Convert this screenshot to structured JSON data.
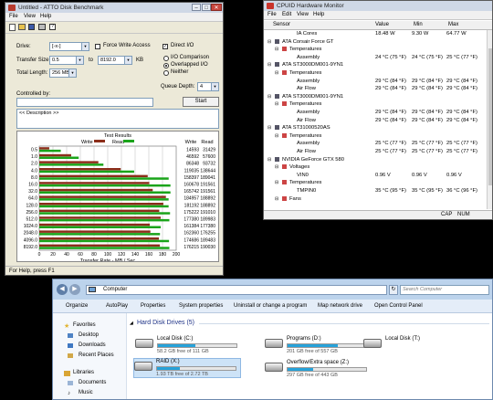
{
  "atto": {
    "title": "Untitled - ATTO Disk Benchmark",
    "menus": [
      "File",
      "View",
      "Help"
    ],
    "drive_label": "Drive:",
    "drive_value": "[-x-]",
    "force_write_access": "Force Write Access",
    "direct_io": "Direct I/O",
    "transfer_size_label": "Transfer Size:",
    "transfer_from": "0.5",
    "transfer_to_label": "to",
    "transfer_to": "8192.0",
    "kb": "KB",
    "total_length_label": "Total Length:",
    "total_length": "256 MB",
    "io_comparison": "I/O Comparison",
    "overlapped_io": "Overlapped I/O",
    "neither": "Neither",
    "queue_depth_label": "Queue Depth:",
    "queue_depth": "4",
    "controlled_by": "Controlled by:",
    "start": "Start",
    "description": "<< Description >>",
    "test_results": "Test Results",
    "legend_write": "Write",
    "legend_read": "Read",
    "col_write": "Write",
    "col_read": "Read",
    "xlabel": "Transfer Rate - MB / Sec",
    "status": "For Help, press F1"
  },
  "chart_data": {
    "type": "bar",
    "title": "Test Results",
    "xlabel": "Transfer Rate - MB / Sec",
    "xlim": [
      0,
      200
    ],
    "xticks": [
      "0",
      "20",
      "40",
      "60",
      "80",
      "100",
      "120",
      "140",
      "160",
      "180",
      "200"
    ],
    "categories": [
      "0.5",
      "1.0",
      "2.0",
      "4.0",
      "8.0",
      "16.0",
      "32.0",
      "64.0",
      "128.0",
      "256.0",
      "512.0",
      "1024.0",
      "2048.0",
      "4096.0",
      "8192.0"
    ],
    "series": [
      {
        "name": "Write",
        "color": "#8b2d1a",
        "values": [
          14.6,
          46.6,
          86.3,
          119.0,
          158.4,
          160.7,
          165.7,
          184.96,
          181.2,
          175.2,
          177.4,
          161.4,
          162.3,
          174.7,
          176.2
        ],
        "labels": [
          "14593",
          "46592",
          "86348",
          "119035",
          "158397",
          "160678",
          "165742",
          "184957",
          "181192",
          "175222",
          "177380",
          "161384",
          "162360",
          "174686",
          "176215"
        ]
      },
      {
        "name": "Read",
        "color": "#1aa41a",
        "values": [
          31.4,
          57.6,
          93.7,
          138.6,
          189.0,
          191.6,
          191.6,
          188.9,
          188.9,
          191.0,
          190.0,
          177.4,
          176.3,
          189.5,
          190.0
        ],
        "labels": [
          "31429",
          "57600",
          "93732",
          "138644",
          "189041",
          "191561",
          "191561",
          "188892",
          "188892",
          "191010",
          "189983",
          "177380",
          "176255",
          "189483",
          "190030"
        ]
      }
    ]
  },
  "hwmon": {
    "title": "CPUID Hardware Monitor",
    "menus": [
      "File",
      "Edit",
      "View",
      "Help"
    ],
    "headers": [
      "Sensor",
      "Value",
      "Min",
      "Max"
    ],
    "rows": [
      {
        "t": "IA Cores",
        "v": "18.48 W",
        "mn": "9.30 W",
        "mx": "64.77 W",
        "lvl": 3
      },
      {
        "t": "ATA Corsair Force GT",
        "v": "",
        "mn": "",
        "mx": "",
        "lvl": 0
      },
      {
        "t": "Temperatures",
        "v": "",
        "mn": "",
        "mx": "",
        "lvl": 1
      },
      {
        "t": "Assembly",
        "v": "24 °C  (75 °F)",
        "mn": "24 °C  (75 °F)",
        "mx": "25 °C  (77 °F)",
        "lvl": 3
      },
      {
        "t": "ATA ST3000DM001-9YN1",
        "v": "",
        "mn": "",
        "mx": "",
        "lvl": 0
      },
      {
        "t": "Temperatures",
        "v": "",
        "mn": "",
        "mx": "",
        "lvl": 1
      },
      {
        "t": "Assembly",
        "v": "29 °C  (84 °F)",
        "mn": "29 °C  (84 °F)",
        "mx": "29 °C  (84 °F)",
        "lvl": 3
      },
      {
        "t": "Air Flow",
        "v": "29 °C  (84 °F)",
        "mn": "29 °C  (84 °F)",
        "mx": "29 °C  (84 °F)",
        "lvl": 3
      },
      {
        "t": "ATA ST3000DM001-9YN1",
        "v": "",
        "mn": "",
        "mx": "",
        "lvl": 0
      },
      {
        "t": "Temperatures",
        "v": "",
        "mn": "",
        "mx": "",
        "lvl": 1
      },
      {
        "t": "Assembly",
        "v": "29 °C  (84 °F)",
        "mn": "29 °C  (84 °F)",
        "mx": "29 °C  (84 °F)",
        "lvl": 3
      },
      {
        "t": "Air Flow",
        "v": "29 °C  (84 °F)",
        "mn": "29 °C  (84 °F)",
        "mx": "29 °C  (84 °F)",
        "lvl": 3
      },
      {
        "t": "ATA ST31000520AS",
        "v": "",
        "mn": "",
        "mx": "",
        "lvl": 0
      },
      {
        "t": "Temperatures",
        "v": "",
        "mn": "",
        "mx": "",
        "lvl": 1
      },
      {
        "t": "Assembly",
        "v": "25 °C  (77 °F)",
        "mn": "25 °C  (77 °F)",
        "mx": "25 °C  (77 °F)",
        "lvl": 3
      },
      {
        "t": "Air Flow",
        "v": "25 °C  (77 °F)",
        "mn": "25 °C  (77 °F)",
        "mx": "25 °C  (77 °F)",
        "lvl": 3
      },
      {
        "t": "NVIDIA GeForce GTX 580",
        "v": "",
        "mn": "",
        "mx": "",
        "lvl": 0
      },
      {
        "t": "Voltages",
        "v": "",
        "mn": "",
        "mx": "",
        "lvl": 1
      },
      {
        "t": "VIN0",
        "v": "0.96 V",
        "mn": "0.96 V",
        "mx": "0.96 V",
        "lvl": 3
      },
      {
        "t": "Temperatures",
        "v": "",
        "mn": "",
        "mx": "",
        "lvl": 1
      },
      {
        "t": "TMPIN0",
        "v": "35 °C  (95 °F)",
        "mn": "35 °C  (95 °F)",
        "mx": "36 °C  (96 °F)",
        "lvl": 3
      },
      {
        "t": "Fans",
        "v": "",
        "mn": "",
        "mx": "",
        "lvl": 1
      }
    ],
    "status": [
      "CAP",
      "NUM"
    ]
  },
  "explorer": {
    "breadcrumb_root": "Computer",
    "search_placeholder": "Search Computer",
    "toolbar": [
      "Organize",
      "AutoPlay",
      "Properties",
      "System properties",
      "Uninstall or change a program",
      "Map network drive",
      "Open Control Panel"
    ],
    "favorites": "Favorites",
    "fav_items": [
      "Desktop",
      "Downloads",
      "Recent Places"
    ],
    "libraries": "Libraries",
    "lib_items": [
      "Documents",
      "Music"
    ],
    "section": "Hard Disk Drives (5)",
    "drives": [
      {
        "name": "Local Disk (C:)",
        "free": "58.2 GB free of 111 GB",
        "used": 0.48
      },
      {
        "name": "Programs (D:)",
        "free": "201 GB free of 557 GB",
        "used": 0.64
      },
      {
        "name": "Local Disk (T:)",
        "free": "",
        "used": null
      },
      {
        "name": "RAID (X:)",
        "free": "1.93 TB free of 2.72 TB",
        "used": 0.29
      },
      {
        "name": "Overflow/Extra space (Z:)",
        "free": "297 GB free of 443 GB",
        "used": 0.33
      }
    ]
  }
}
